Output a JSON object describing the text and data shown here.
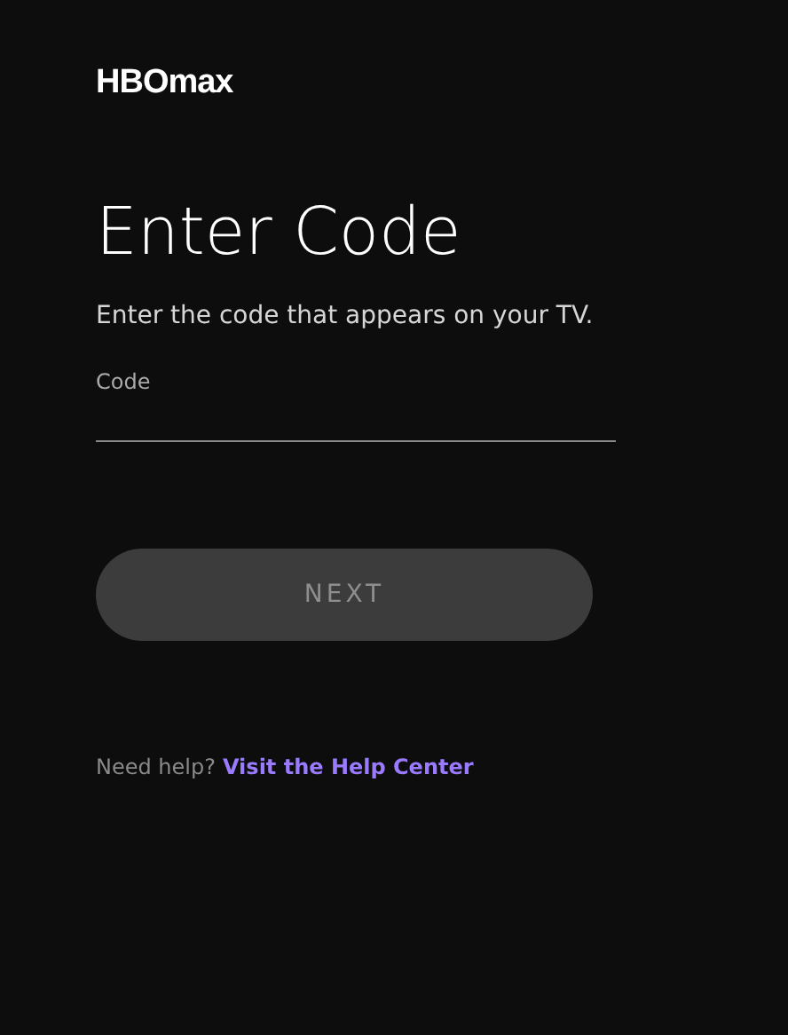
{
  "logo": "HBOmax",
  "heading": "Enter Code",
  "instructions": "Enter the code that appears on your TV.",
  "code_field": {
    "label": "Code"
  },
  "next_button": {
    "label": "NEXT",
    "disabled": true
  },
  "help": {
    "text": "Need help?",
    "link": "Visit the Help Center"
  }
}
